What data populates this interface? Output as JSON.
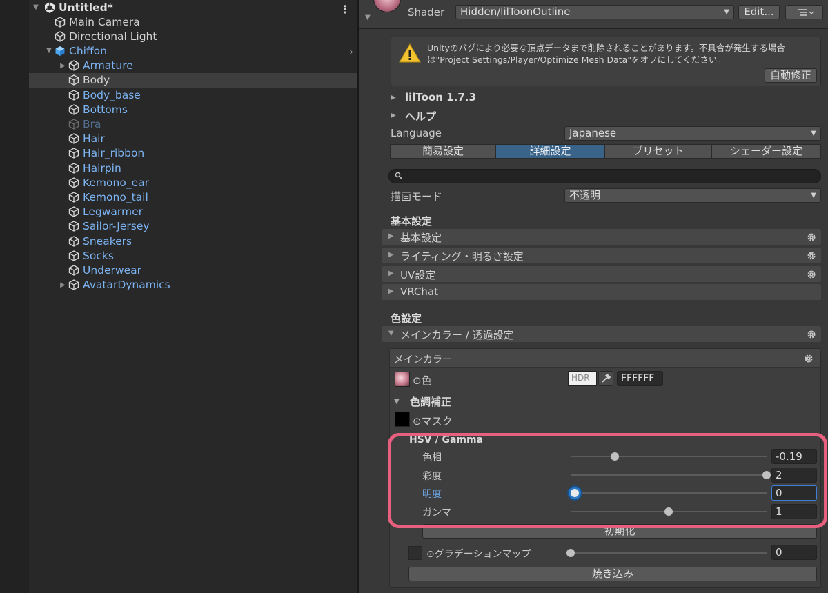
{
  "hierarchy": {
    "scene_name": "Untitled*",
    "scene_menu_icon": "kebab-menu-icon",
    "items": [
      {
        "label": "Main Camera",
        "indent": 1,
        "style": "normal",
        "fold": ""
      },
      {
        "label": "Directional Light",
        "indent": 1,
        "style": "normal",
        "fold": ""
      },
      {
        "label": "Chiffon",
        "indent": 1,
        "style": "prefab-root",
        "fold": "▼"
      },
      {
        "label": "Armature",
        "indent": 2,
        "style": "prefab",
        "fold": "▶"
      },
      {
        "label": "Body",
        "indent": 2,
        "style": "selected",
        "fold": ""
      },
      {
        "label": "Body_base",
        "indent": 2,
        "style": "prefab",
        "fold": ""
      },
      {
        "label": "Bottoms",
        "indent": 2,
        "style": "prefab",
        "fold": ""
      },
      {
        "label": "Bra",
        "indent": 2,
        "style": "inactive",
        "fold": ""
      },
      {
        "label": "Hair",
        "indent": 2,
        "style": "prefab",
        "fold": ""
      },
      {
        "label": "Hair_ribbon",
        "indent": 2,
        "style": "prefab",
        "fold": ""
      },
      {
        "label": "Hairpin",
        "indent": 2,
        "style": "prefab",
        "fold": ""
      },
      {
        "label": "Kemono_ear",
        "indent": 2,
        "style": "prefab",
        "fold": ""
      },
      {
        "label": "Kemono_tail",
        "indent": 2,
        "style": "prefab",
        "fold": ""
      },
      {
        "label": "Legwarmer",
        "indent": 2,
        "style": "prefab",
        "fold": ""
      },
      {
        "label": "Sailor-Jersey",
        "indent": 2,
        "style": "prefab",
        "fold": ""
      },
      {
        "label": "Sneakers",
        "indent": 2,
        "style": "prefab",
        "fold": ""
      },
      {
        "label": "Socks",
        "indent": 2,
        "style": "prefab",
        "fold": ""
      },
      {
        "label": "Underwear",
        "indent": 2,
        "style": "prefab",
        "fold": ""
      },
      {
        "label": "AvatarDynamics",
        "indent": 2,
        "style": "prefab",
        "fold": "▶"
      }
    ],
    "chiffon_arrow": "›"
  },
  "inspector": {
    "shader_label": "Shader",
    "shader_value": "Hidden/lilToonOutline",
    "edit_button": "Edit...",
    "warning_text": "Unityのバグにより必要な頂点データまで削除されることがあります。不具合が発生する場合は\"Project Settings/Player/Optimize Mesh Data\"をオフにしてください。",
    "auto_fix_button": "自動修正",
    "liltoon_version": "lilToon 1.7.3",
    "help_label": "ヘルプ",
    "language_label": "Language",
    "language_value": "Japanese",
    "tabs": [
      "簡易設定",
      "詳細設定",
      "プリセット",
      "シェーダー設定"
    ],
    "active_tab": 1,
    "render_mode_label": "描画モード",
    "render_mode_value": "不透明",
    "basic_header": "基本設定",
    "basic_sections": [
      {
        "label": "基本設定",
        "gear": true
      },
      {
        "label": "ライティング・明るさ設定",
        "gear": true
      },
      {
        "label": "UV設定",
        "gear": true
      },
      {
        "label": "VRChat",
        "gear": false
      }
    ],
    "color_header": "色設定",
    "main_color_section": "メインカラー / 透過設定",
    "main_color_box_title": "メインカラー",
    "color_prop_label": "⊙色",
    "hdr_label": "HDR",
    "hex_value": "FFFFFF",
    "color_correction_label": "色調補正",
    "mask_label": "⊙マスク",
    "hsv_header": "HSV / Gamma",
    "hsv": [
      {
        "label": "色相",
        "value": "-0.19",
        "position": 0.225,
        "active": false
      },
      {
        "label": "彩度",
        "value": "2",
        "position": 1.0,
        "active": false
      },
      {
        "label": "明度",
        "value": "0",
        "position": 0.02,
        "active": true
      },
      {
        "label": "ガンマ",
        "value": "1",
        "position": 0.5,
        "active": false
      }
    ],
    "reset_button": "初期化",
    "gradation_label": "⊙グラデーションマップ",
    "gradation_value": "0",
    "gradation_position": 0.0,
    "bake_button": "焼き込み"
  },
  "colors": {
    "prefab_blue": "#7cb3f2",
    "active_tab": "#3a6389",
    "highlight": "#e8607f",
    "warning_yellow": "#f2c230",
    "focus_blue": "#3b7fd6"
  }
}
